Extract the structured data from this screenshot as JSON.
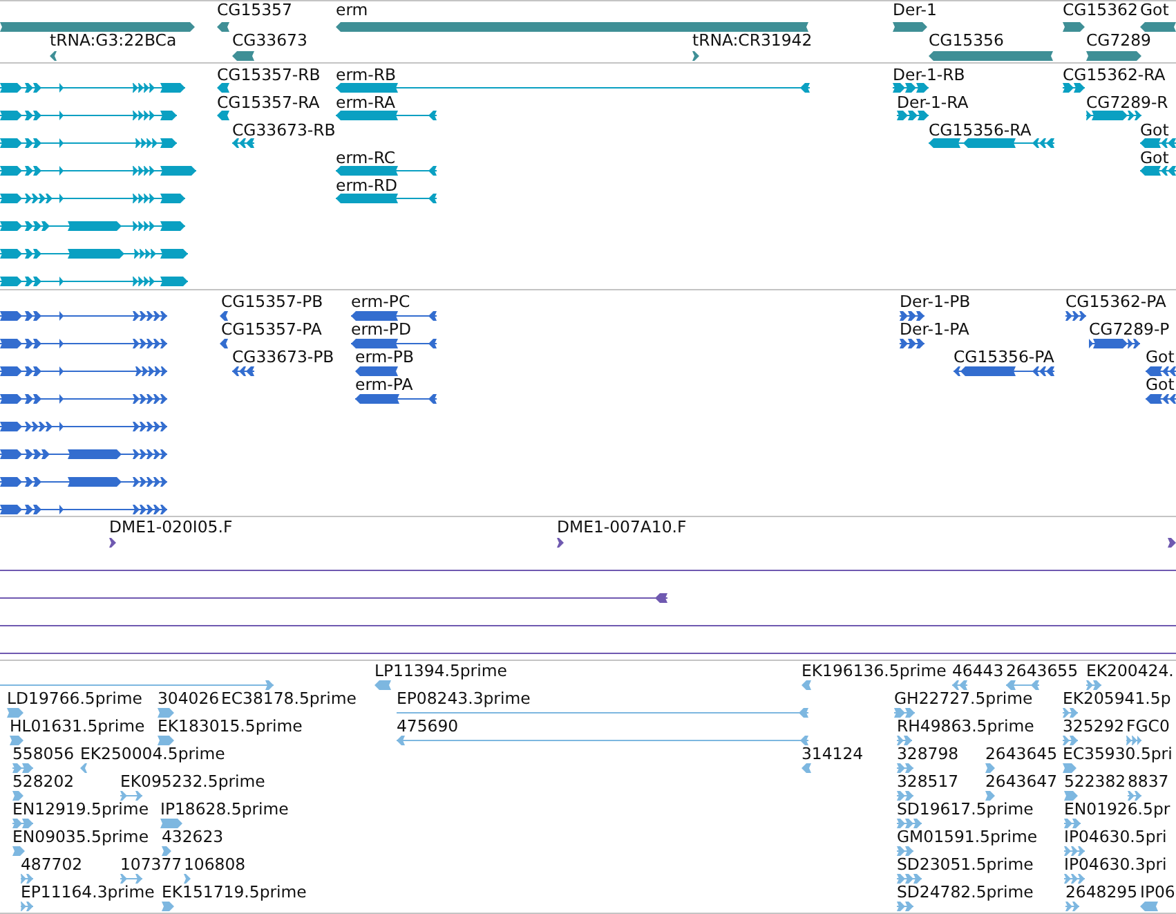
{
  "tracks": [
    {
      "kind": "gene",
      "features": [
        {
          "reverse": false
        },
        {
          "label": "CG15357",
          "reverse": true
        },
        {
          "label": "erm",
          "reverse": true
        },
        {
          "label": "Der-1",
          "reverse": false
        },
        {
          "label": "CG15362",
          "reverse": false
        },
        {
          "label": "Got",
          "reverse": true
        },
        {
          "label": "tRNA:G3:22BCa",
          "reverse": true
        },
        {
          "label": "CG33673",
          "reverse": true
        },
        {
          "label": "tRNA:CR31942",
          "reverse": false
        },
        {
          "label": "CG15356",
          "reverse": true
        },
        {
          "label": "CG7289",
          "reverse": false
        }
      ]
    },
    {
      "kind": "transcript",
      "features": [
        {
          "reverse": false
        },
        {
          "label": "CG15357-RB",
          "reverse": true
        },
        {
          "label": "erm-RB",
          "reverse": true
        },
        {
          "label": "Der-1-RB",
          "reverse": false
        },
        {
          "label": "CG15362-RA",
          "reverse": false
        },
        {
          "reverse": false
        },
        {
          "label": "CG15357-RA",
          "reverse": true
        },
        {
          "label": "erm-RA",
          "reverse": true
        },
        {
          "label": "Der-1-RA",
          "reverse": false
        },
        {
          "label": "CG7289-R",
          "reverse": false
        },
        {
          "reverse": false
        },
        {
          "label": "CG33673-RB",
          "reverse": true
        },
        {
          "label": "CG15356-RA",
          "reverse": true
        },
        {
          "label": "Got",
          "reverse": true
        },
        {
          "reverse": false
        },
        {
          "label": "erm-RC",
          "reverse": true
        },
        {
          "label": "Got",
          "reverse": true
        },
        {
          "reverse": false
        },
        {
          "label": "erm-RD",
          "reverse": true
        },
        {
          "reverse": false
        },
        {
          "reverse": false
        },
        {
          "reverse": false
        }
      ]
    },
    {
      "kind": "protein",
      "features": [
        {
          "reverse": false
        },
        {
          "label": "CG15357-PB",
          "reverse": true
        },
        {
          "label": "erm-PC",
          "reverse": true
        },
        {
          "label": "Der-1-PB",
          "reverse": false
        },
        {
          "label": "CG15362-PA",
          "reverse": false
        },
        {
          "reverse": false
        },
        {
          "label": "CG15357-PA",
          "reverse": true
        },
        {
          "label": "erm-PD",
          "reverse": true
        },
        {
          "label": "Der-1-PA",
          "reverse": false
        },
        {
          "label": "CG7289-P",
          "reverse": false
        },
        {
          "reverse": false
        },
        {
          "label": "CG33673-PB",
          "reverse": true
        },
        {
          "label": "erm-PB",
          "reverse": true
        },
        {
          "label": "CG15356-PA",
          "reverse": true
        },
        {
          "label": "Got",
          "reverse": true
        },
        {
          "reverse": false
        },
        {
          "label": "erm-PA",
          "reverse": true
        },
        {
          "label": "Got",
          "reverse": true
        },
        {
          "reverse": false
        },
        {
          "reverse": false
        },
        {
          "reverse": false
        },
        {
          "reverse": false
        }
      ]
    },
    {
      "kind": "clone",
      "features": [
        {
          "label": "DME1-020I05.F",
          "reverse": false
        },
        {
          "label": "DME1-007A10.F",
          "reverse": false
        },
        {
          "reverse": false
        },
        {
          "reverse": true
        }
      ]
    },
    {
      "kind": "est",
      "features": [
        {
          "reverse": false
        },
        {
          "label": "LP11394.5prime",
          "reverse": true
        },
        {
          "label": "EK196136.5prime",
          "reverse": true
        },
        {
          "label": "46443",
          "reverse": true
        },
        {
          "label": "2643655",
          "reverse": true
        },
        {
          "label": "EK200424.",
          "reverse": false
        },
        {
          "label": "LD19766.5prime",
          "reverse": false
        },
        {
          "label": "304026",
          "reverse": false
        },
        {
          "label": "EC38178.5prime"
        },
        {
          "label": "EP08243.3prime",
          "reverse": true
        },
        {
          "label": "GH22727.5prime",
          "reverse": false
        },
        {
          "label": "EK205941.5p",
          "reverse": false
        },
        {
          "label": "HL01631.5prime",
          "reverse": false
        },
        {
          "label": "EK183015.5prime",
          "reverse": false
        },
        {
          "label": "475690",
          "reverse": true
        },
        {
          "label": "RH49863.5prime",
          "reverse": false
        },
        {
          "label": "325292",
          "reverse": false
        },
        {
          "label": "FGC0",
          "reverse": false
        },
        {
          "label": "558056",
          "reverse": false
        },
        {
          "label": "EK250004.5prime",
          "reverse": true
        },
        {
          "label": "314124",
          "reverse": true
        },
        {
          "label": "328798",
          "reverse": false
        },
        {
          "label": "2643645",
          "reverse": false
        },
        {
          "label": "EC35930.5pri",
          "reverse": false
        },
        {
          "label": "528202",
          "reverse": false
        },
        {
          "label": "EK095232.5prime",
          "reverse": false
        },
        {
          "label": "328517",
          "reverse": false
        },
        {
          "label": "2643647",
          "reverse": false
        },
        {
          "label": "522382",
          "reverse": false
        },
        {
          "label": "8837",
          "reverse": false
        },
        {
          "label": "EN12919.5prime",
          "reverse": false
        },
        {
          "label": "IP18628.5prime",
          "reverse": false
        },
        {
          "label": "SD19617.5prime",
          "reverse": false
        },
        {
          "label": "EN01926.5pr",
          "reverse": false
        },
        {
          "label": "EN09035.5prime",
          "reverse": false
        },
        {
          "label": "432623",
          "reverse": false
        },
        {
          "label": "GM01591.5prime",
          "reverse": false
        },
        {
          "label": "IP04630.5pri",
          "reverse": false
        },
        {
          "label": "487702",
          "reverse": false
        },
        {
          "label": "107377",
          "reverse": false
        },
        {
          "label": "106808",
          "reverse": false
        },
        {
          "label": "SD23051.5prime",
          "reverse": false
        },
        {
          "label": "IP04630.3pri",
          "reverse": false
        },
        {
          "label": "EP11164.3prime",
          "reverse": false
        },
        {
          "label": "EK151719.5prime",
          "reverse": false
        },
        {
          "label": "SD24782.5prime",
          "reverse": false
        },
        {
          "label": "2648295",
          "reverse": false
        },
        {
          "label": "IP06",
          "reverse": true
        }
      ]
    }
  ]
}
